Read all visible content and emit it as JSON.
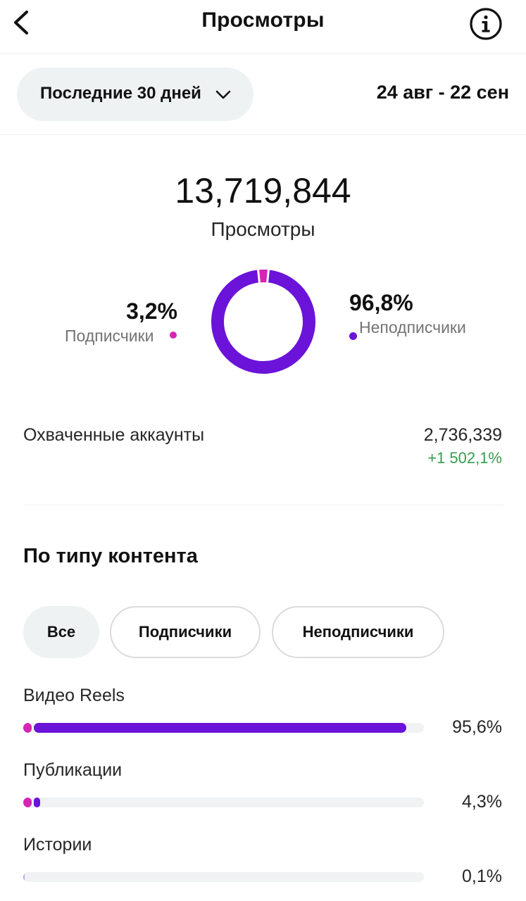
{
  "header": {
    "title": "Просмотры",
    "back_icon": "chevron-left-icon",
    "info_icon": "info-icon"
  },
  "period": {
    "label": "Последние 30 дней",
    "icon": "chevron-down-icon",
    "date_range": "24 авг - 22 сен"
  },
  "summary": {
    "total": "13,719,844",
    "total_label": "Просмотры",
    "followers": {
      "pct": "3,2%",
      "label": "Подписчики",
      "color": "#d625b5",
      "fraction": 0.032
    },
    "non_followers": {
      "pct": "96,8%",
      "label": "Неподписчики",
      "color": "#6b13d9",
      "fraction": 0.968
    }
  },
  "accounts_reached": {
    "label": "Охваченные аккаунты",
    "value": "2,736,339",
    "delta": "+1 502,1%",
    "delta_color": "#3a9a4f"
  },
  "content_type": {
    "title": "По типу контента",
    "filters": [
      "Все",
      "Подписчики",
      "Неподписчики"
    ],
    "selected_filter": "Все",
    "rows": [
      {
        "label": "Видео Reels",
        "pct": "95,6%",
        "value": 0.956,
        "followers_share": 0.02
      },
      {
        "label": "Публикации",
        "pct": "4,3%",
        "value": 0.043,
        "followers_share": 0.3
      },
      {
        "label": "Истории",
        "pct": "0,1%",
        "value": 0.001,
        "followers_share": 0.0
      }
    ]
  }
}
